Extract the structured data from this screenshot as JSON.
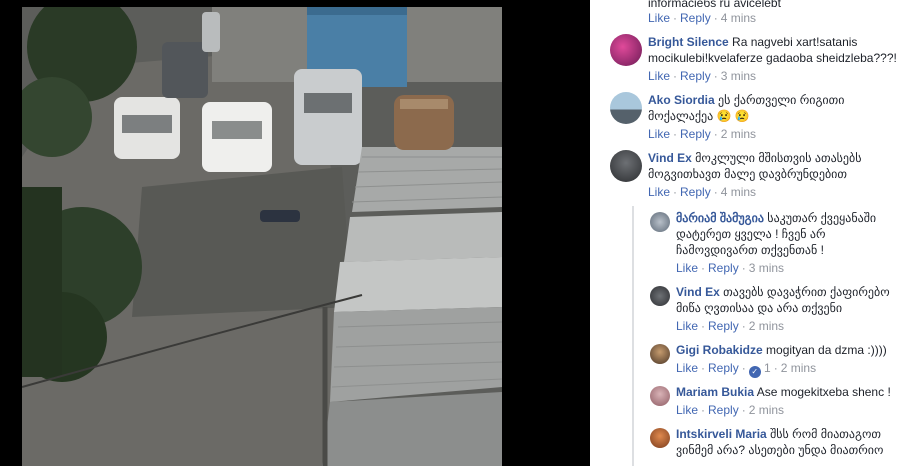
{
  "comments": [
    {
      "id": "c0",
      "name": "",
      "text": "informacieбs ru avicelebt",
      "actions": {
        "like": "Like",
        "reply": "Reply",
        "time": "4 mins"
      }
    },
    {
      "id": "c1",
      "name": "Bright Silence",
      "text": "Ra nagvebi xart!satanis mocikulebi!kvelaferze gadaoba sheidzleba???!",
      "actions": {
        "like": "Like",
        "reply": "Reply",
        "time": "3 mins"
      }
    },
    {
      "id": "c2",
      "name": "Ako Siordia",
      "text": "ეს ქართველი რიგითი მოქალაქეა",
      "emoji": "😢 😢",
      "actions": {
        "like": "Like",
        "reply": "Reply",
        "time": "2 mins"
      }
    },
    {
      "id": "c3",
      "name": "Vind Ex",
      "text": "მოკლული მშისთვის ათასებს მოგვითხავთ მალე დავბრუნდებით",
      "actions": {
        "like": "Like",
        "reply": "Reply",
        "time": "4 mins"
      }
    }
  ],
  "replies": [
    {
      "id": "r1",
      "name": "მარიამ შამუგია",
      "text": "საკუთარ ქვეყანაში დატერეთ ყველა ! ჩვენ არ ჩამოვდივართ თქვენთან !",
      "actions": {
        "like": "Like",
        "reply": "Reply",
        "time": "3 mins"
      }
    },
    {
      "id": "r2",
      "name": "Vind Ex",
      "text": "თავებს დავაჭრით ქაფირებო მიწა ღვთისაა და არა თქვენი",
      "actions": {
        "like": "Like",
        "reply": "Reply",
        "time": "2 mins"
      }
    },
    {
      "id": "r3",
      "name": "Gigi Robakidze",
      "text": "mogityan da dzma :))))",
      "actions": {
        "like": "Like",
        "reply": "Reply",
        "likes": "1",
        "time": "2 mins"
      }
    },
    {
      "id": "r4",
      "name": "Mariam Bukia",
      "text": "Ase mogekitxeba shenc !",
      "actions": {
        "like": "Like",
        "reply": "Reply",
        "time": "2 mins"
      }
    },
    {
      "id": "r5",
      "name": "Intskirveli Maria",
      "text": "შსს რომ მიათაგოთ ვინმემ არა? ასეთები უნდა მიათრიო",
      "actions": {}
    }
  ],
  "colors": {
    "link": "#4267b2",
    "name": "#365899",
    "meta": "#90949c",
    "text": "#1d2129"
  }
}
